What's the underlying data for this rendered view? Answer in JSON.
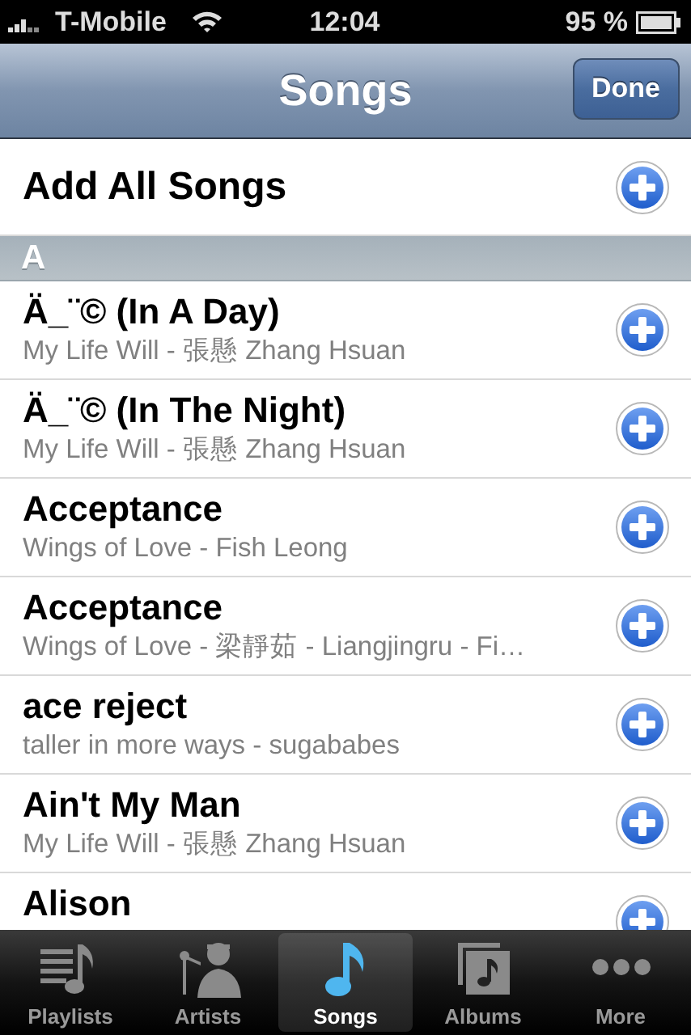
{
  "status_bar": {
    "carrier": "T-Mobile",
    "time": "12:04",
    "battery": "95 %"
  },
  "nav_bar": {
    "title": "Songs",
    "button": "Done"
  },
  "add_all": {
    "label": "Add All Songs"
  },
  "sections": [
    {
      "header": "A",
      "rows": [
        {
          "title": "Ä_¨© (In A Day)",
          "subtitle": "My Life Will - 張懸 Zhang Hsuan"
        },
        {
          "title": "Ä_¨© (In The Night)",
          "subtitle": "My Life Will - 張懸 Zhang Hsuan"
        },
        {
          "title": "Acceptance",
          "subtitle": "Wings of Love - Fish Leong"
        },
        {
          "title": "Acceptance",
          "subtitle": "Wings of Love - 梁靜茹 - Liangjingru - Fi…"
        },
        {
          "title": "ace reject",
          "subtitle": "taller in more ways - sugababes"
        },
        {
          "title": "Ain't My Man",
          "subtitle": "My Life Will - 張懸 Zhang Hsuan"
        },
        {
          "title": "Alison"
        }
      ]
    }
  ],
  "tabs": [
    {
      "label": "Playlists",
      "selected": false
    },
    {
      "label": "Artists",
      "selected": false
    },
    {
      "label": "Songs",
      "selected": true
    },
    {
      "label": "Albums",
      "selected": false
    },
    {
      "label": "More",
      "selected": false
    }
  ]
}
